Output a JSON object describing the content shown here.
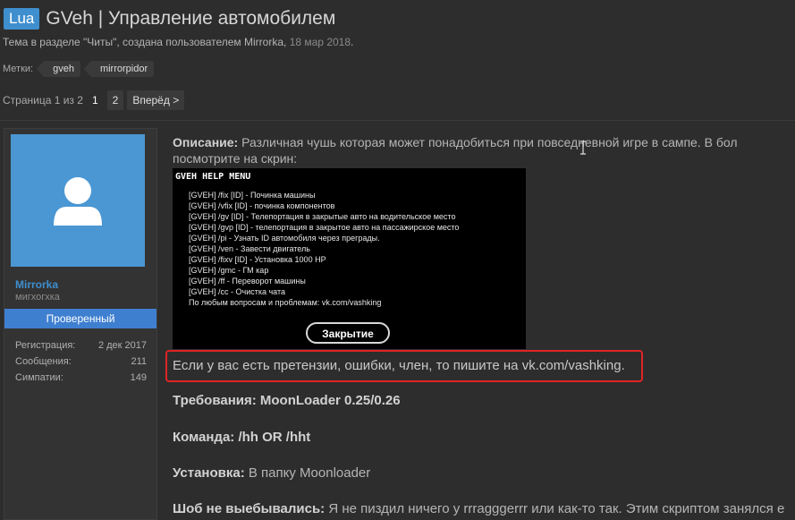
{
  "thread": {
    "prefix": "Lua",
    "title": "GVeh | Управление автомобилем",
    "meta_text": "Тема в разделе \"Читы\", создана пользователем Mirrorka,",
    "date": "18 мар 2018",
    "meta_end": "."
  },
  "tags": {
    "label": "Метки:",
    "items": [
      "gveh",
      "mirrorpidor"
    ]
  },
  "pager": {
    "text": "Страница 1 из 2",
    "pages": [
      "1",
      "2"
    ],
    "next": "Вперёд >"
  },
  "user": {
    "name": "Mirrorka",
    "title": "мигхогхка",
    "badge": "Проверенный",
    "stats": [
      {
        "label": "Регистрация:",
        "value": "2 дек 2017"
      },
      {
        "label": "Сообщения:",
        "value": "211"
      },
      {
        "label": "Симпатии:",
        "value": "149"
      }
    ]
  },
  "post": {
    "desc_label": "Описание:",
    "desc_text": " Различная чушь которая может понадобиться при повседневной игре в сампе. В бол",
    "desc_line2": "посмотрите на скрин:",
    "help_title": "GVEH HELP MENU",
    "help_lines": [
      "[GVEH] /fix [ID] - Починка машины",
      "[GVEH] /vfix [ID] - починка компонентов",
      "[GVEH] /gv [ID] - Телепортация в закрытые авто на водительское место",
      "[GVEH] /gvp [ID] - телепортация в закрытое авто на пассажирское место",
      "[GVEH] /pi - Узнать ID автомобиля через преграды.",
      "[GVEH] /ven - Завести двигатель",
      "[GVEH] /fixv [ID] - Установка 1000 HP",
      "[GVEH] /gmc - ГМ кар",
      "[GVEH] /ff - Переворот машины",
      "[GVEH] /cc - Очистка чата",
      "По любым вопросам и проблемам: vk.com/vashking"
    ],
    "close_button": "Закрытие",
    "highlight": "Если у вас есть претензии, ошибки, член, то пишите на vk.com/vashking.",
    "req_label": "Требования: MoonLoader 0.25/0.26",
    "cmd_label": "Команда: /hh OR /hht",
    "install_label": "Установка:",
    "install_text": " В папку Moonloader",
    "shob_label": "Шоб не выебывались:",
    "shob_text": " Я не пиздил ничего у rrragggerrr или как-то так. Этим скриптом занялся е"
  },
  "colors": {
    "accent": "#3f8fce",
    "badge": "#3f7fd0",
    "highlight_border": "#e02424",
    "background": "#2d2d2d"
  }
}
